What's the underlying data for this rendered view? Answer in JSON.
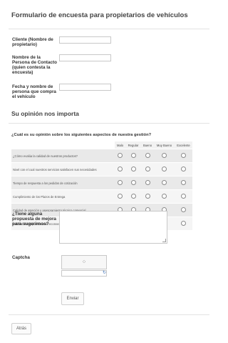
{
  "form": {
    "title": "Formulario de encuesta para propietarios de vehículos",
    "fields": {
      "cliente_label": "Cliente (Nombre de propietario)",
      "contacto_label": "Nombre de la Persona de Contacto (quien contesta la encuesta)",
      "fecha_label": "Fecha y nombre de persona que compra el vehículo"
    },
    "section_title": "Su opinión nos importa",
    "matrix": {
      "question": "¿Cuál es su opinión sobre los siguientes aspectos de nuestra gestión?",
      "columns": [
        "Malo",
        "Regular",
        "Bueno",
        "Muy Bueno",
        "Excelente"
      ],
      "rows": [
        "¿Cómo evalúa la calidad de nuestros productos?",
        "Nivel con el cual nuestros servicios satisfacen sus necesidades",
        "Tiempo de respuesta a los pedidos de cotización",
        "Cumplimiento de los Plazos de Entrega",
        "Calidad de atención y asesoramiento técnico comercial",
        "Calidad de respuesta ante inconvenientes"
      ]
    },
    "suggestion_label": "¿Tiene alguna propuesta de mejora para sugerirnos?",
    "captcha_label": "Captcha",
    "submit_label": "Enviar",
    "back_label": "Atrás"
  },
  "icons": {
    "spinner": "loading-spinner-icon",
    "refresh": "refresh-icon"
  }
}
